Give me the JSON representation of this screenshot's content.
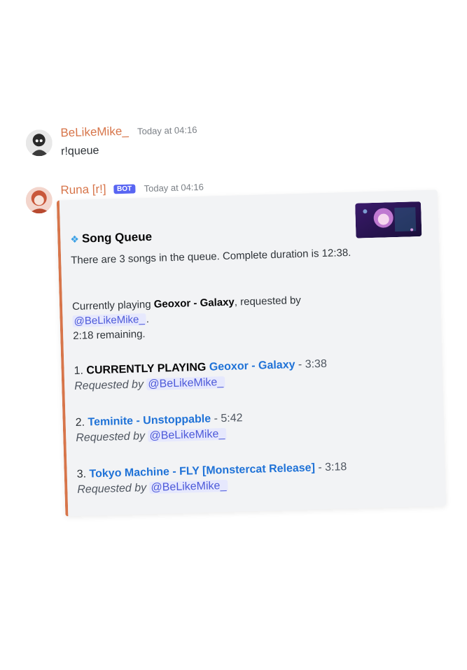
{
  "messages": [
    {
      "username": "BeLikeMike_",
      "timestamp": "Today at 04:16",
      "content": "r!queue"
    },
    {
      "username": "Runa [r!]",
      "bot_tag": "BOT",
      "timestamp": "Today at 04:16",
      "embed": {
        "accent_color": "#d7754a",
        "title": "Song Queue",
        "summary": "There are 3 songs in the queue. Complete duration is 12:38.",
        "now_playing_prefix": "Currently playing",
        "now_playing_song": "Geoxor - Galaxy",
        "now_playing_suffix": ", requested by",
        "now_playing_mention": "@BeLikeMike_",
        "remaining": "2:18 remaining.",
        "queue": [
          {
            "index": "1.",
            "tag": "CURRENTLY PLAYING",
            "song": "Geoxor - Galaxy",
            "duration": "- 3:38",
            "requested_label": "Requested by",
            "requested_mention": "@BeLikeMike_"
          },
          {
            "index": "2.",
            "song": "Teminite - Unstoppable",
            "duration": "- 5:42",
            "requested_label": "Requested by",
            "requested_mention": "@BeLikeMike_"
          },
          {
            "index": "3.",
            "song": "Tokyo Machine - FLY [Monstercat Release]",
            "duration": "- 3:18",
            "requested_label": "Requested by",
            "requested_mention": "@BeLikeMike_"
          }
        ]
      }
    }
  ]
}
